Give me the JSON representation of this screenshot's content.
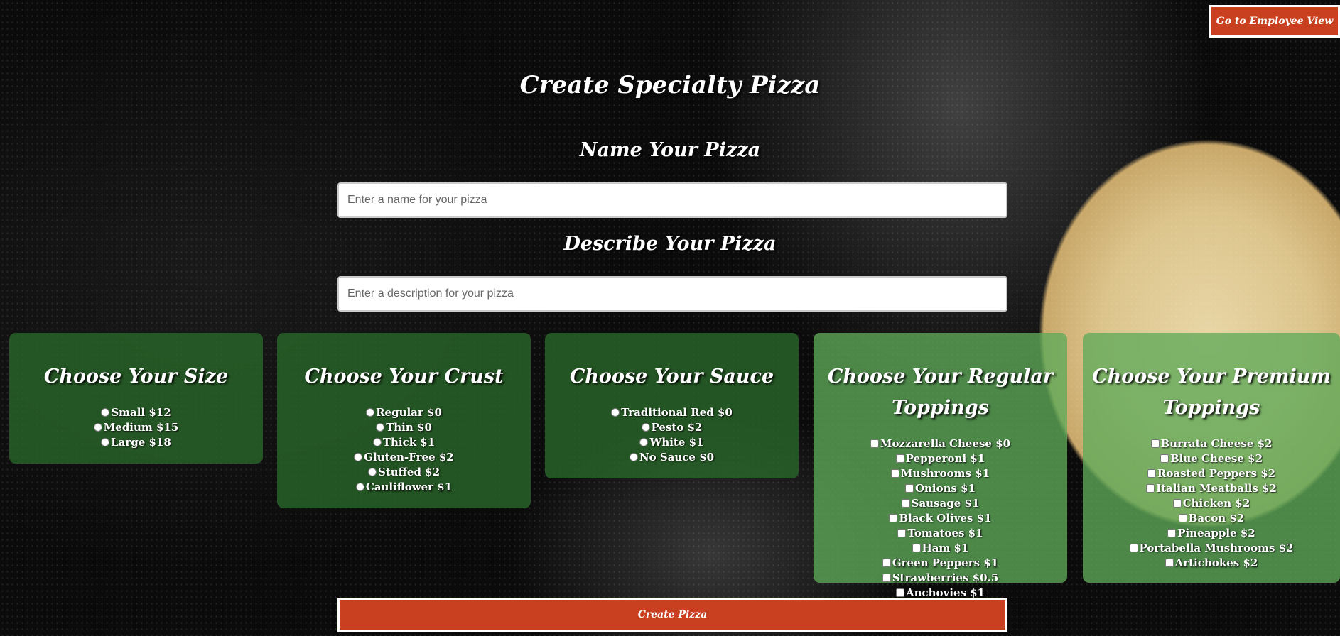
{
  "header": {
    "employee_view_label": "Go to Employee View"
  },
  "page_title": "Create Specialty Pizza",
  "name_section": {
    "label": "Name Your Pizza",
    "placeholder": "Enter a name for your pizza",
    "value": ""
  },
  "description_section": {
    "label": "Describe Your Pizza",
    "placeholder": "Enter a description for your pizza",
    "value": ""
  },
  "size": {
    "title": "Choose Your Size",
    "options": [
      "Small $12",
      "Medium $15",
      "Large $18"
    ]
  },
  "crust": {
    "title": "Choose Your Crust",
    "options": [
      "Regular $0",
      "Thin $0",
      "Thick $1",
      "Gluten-Free $2",
      "Stuffed $2",
      "Cauliflower $1"
    ]
  },
  "sauce": {
    "title": "Choose Your Sauce",
    "options": [
      "Traditional Red $0",
      "Pesto $2",
      "White $1",
      "No Sauce $0"
    ]
  },
  "regular_toppings": {
    "title": "Choose Your Regular Toppings",
    "options": [
      "Mozzarella Cheese $0",
      "Pepperoni $1",
      "Mushrooms $1",
      "Onions $1",
      "Sausage $1",
      "Black Olives $1",
      "Tomatoes $1",
      "Ham $1",
      "Green Peppers $1",
      "Strawberries $0.5",
      "Anchovies $1"
    ]
  },
  "premium_toppings": {
    "title": "Choose Your Premium Toppings",
    "options": [
      "Burrata Cheese $2",
      "Blue Cheese $2",
      "Roasted Peppers $2",
      "Italian Meatballs $2",
      "Chicken $2",
      "Bacon $2",
      "Pineapple $2",
      "Portabella Mushrooms $2",
      "Artichokes $2"
    ]
  },
  "create_button_label": "Create Pizza"
}
